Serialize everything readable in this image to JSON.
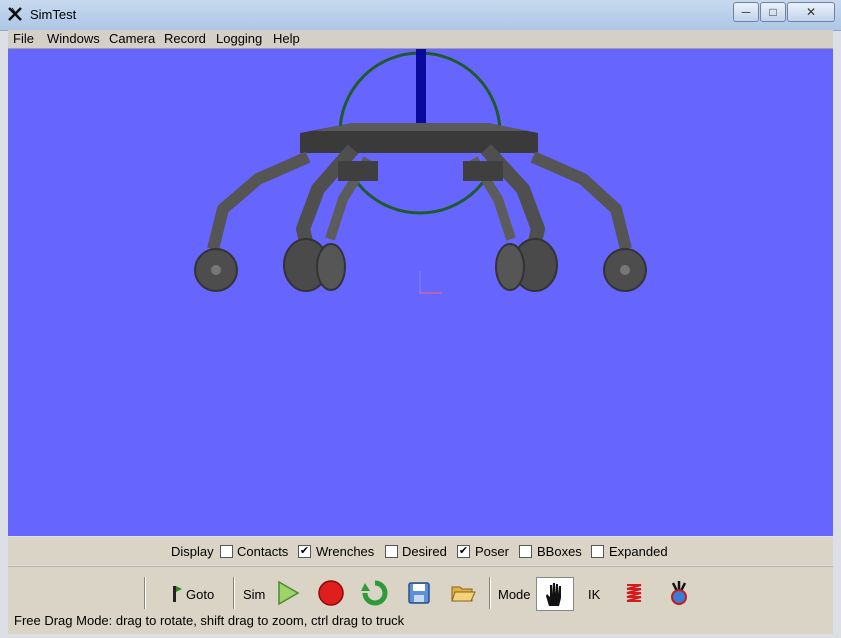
{
  "window": {
    "title": "SimTest",
    "min_label": "─",
    "max_label": "□",
    "close_label": "✕"
  },
  "menu": [
    "File",
    "Windows",
    "Camera",
    "Record",
    "Logging",
    "Help"
  ],
  "display": {
    "label": "Display",
    "options": [
      {
        "label": "Contacts",
        "checked": false,
        "mark": ""
      },
      {
        "label": "Wrenches",
        "checked": true,
        "mark": "✔"
      },
      {
        "label": "Desired",
        "checked": false,
        "mark": ""
      },
      {
        "label": "Poser",
        "checked": true,
        "mark": "✔"
      },
      {
        "label": "BBoxes",
        "checked": false,
        "mark": ""
      },
      {
        "label": "Expanded",
        "checked": false,
        "mark": ""
      }
    ]
  },
  "toolbar": {
    "goto_label": "Goto",
    "sim_label": "Sim",
    "mode_label": "Mode",
    "ik_label": "IK",
    "icons": [
      "flag-icon",
      "play-icon",
      "record-icon",
      "reset-icon",
      "save-icon",
      "open-folder-icon",
      "hand-icon",
      "spring-icon",
      "robot-icon"
    ]
  },
  "status": {
    "text": "Free Drag Mode: drag to rotate, shift drag to zoom, ctrl drag to truck"
  },
  "colors": {
    "viewport": "#6666ff",
    "robot": "#4a4a4a",
    "pose_ring": "#1f5a2a",
    "pose_axis": "#0a0a9c"
  }
}
